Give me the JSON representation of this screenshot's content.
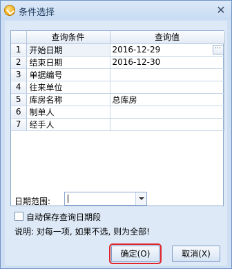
{
  "window": {
    "title": "条件选择",
    "close_glyph": "✕"
  },
  "grid": {
    "headers": {
      "index": "",
      "condition": "查询条件",
      "value": "查询值"
    },
    "rows": [
      {
        "index": "1",
        "condition": "开始日期",
        "value": "2016-12-29"
      },
      {
        "index": "2",
        "condition": "结束日期",
        "value": "2016-12-30"
      },
      {
        "index": "3",
        "condition": "单据编号",
        "value": ""
      },
      {
        "index": "4",
        "condition": "往来单位",
        "value": ""
      },
      {
        "index": "5",
        "condition": "库房名称",
        "value": "总库房"
      },
      {
        "index": "6",
        "condition": "制单人",
        "value": ""
      },
      {
        "index": "7",
        "condition": "经手人",
        "value": ""
      }
    ],
    "ellipsis_glyph": "···"
  },
  "date_range": {
    "label": "日期范围:",
    "value": ""
  },
  "autosave": {
    "label": "自动保存查询日期段",
    "checked": false
  },
  "note": "说明: 对每一项, 如果不选, 则为全部!",
  "buttons": {
    "ok": "确定(O)",
    "cancel": "取消(X)"
  }
}
